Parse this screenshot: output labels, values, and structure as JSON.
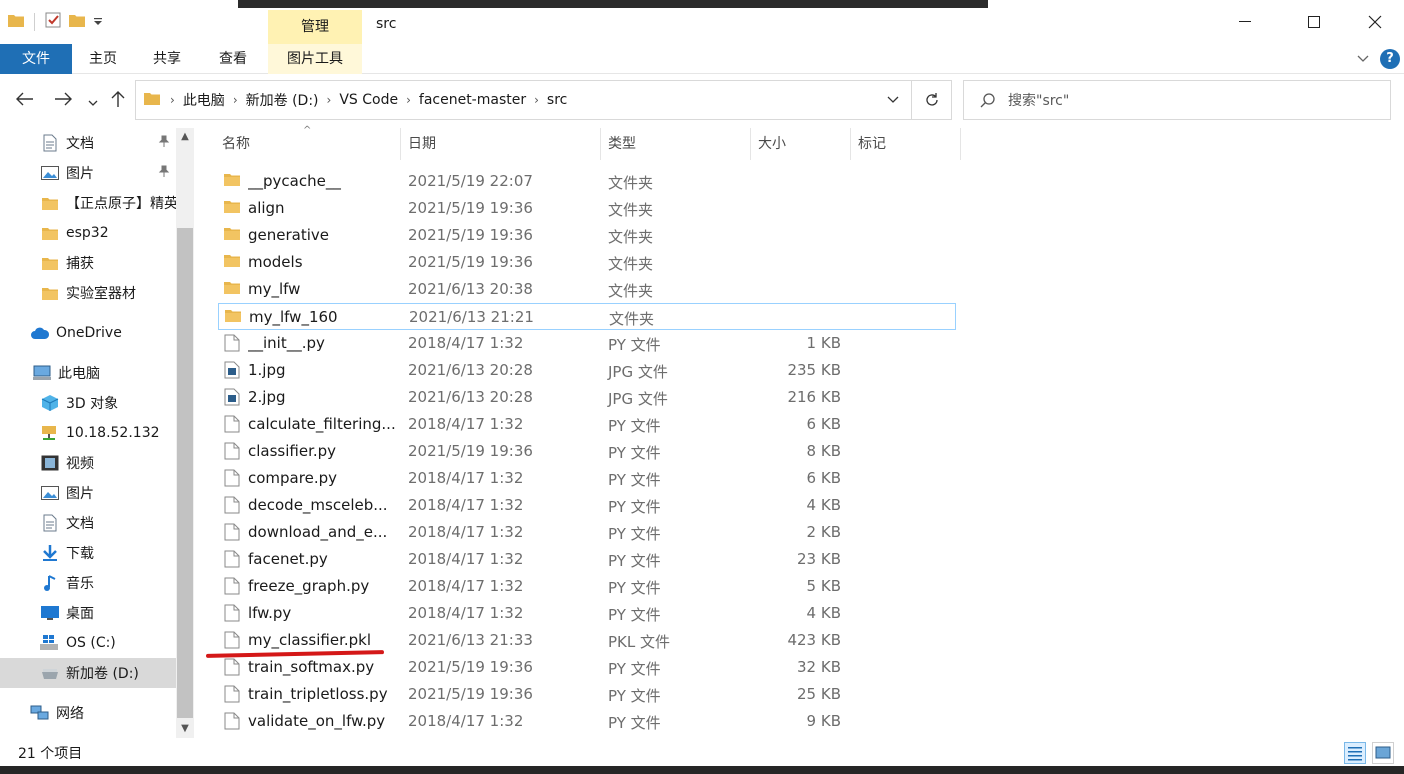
{
  "window": {
    "title": "src",
    "context_tab_top": "管理",
    "minimize": "—",
    "maximize": "☐",
    "close": "✕"
  },
  "ribbon": {
    "tabs": [
      "文件",
      "主页",
      "共享",
      "查看"
    ],
    "context_tab": "图片工具",
    "help": "?"
  },
  "address": {
    "crumbs": [
      "此电脑",
      "新加卷 (D:)",
      "VS Code",
      "facenet-master",
      "src"
    ]
  },
  "search": {
    "placeholder": "搜索\"src\""
  },
  "sidebar": {
    "items": [
      {
        "label": "文档",
        "icon": "document-icon",
        "pinned": true
      },
      {
        "label": "图片",
        "icon": "picture-icon",
        "pinned": true
      },
      {
        "label": "【正点原子】精英",
        "icon": "folder-icon"
      },
      {
        "label": "esp32",
        "icon": "folder-icon"
      },
      {
        "label": "捕获",
        "icon": "folder-icon"
      },
      {
        "label": "实验室器材",
        "icon": "folder-icon"
      },
      {
        "label": "OneDrive",
        "icon": "cloud-icon"
      },
      {
        "label": "此电脑",
        "icon": "computer-icon"
      },
      {
        "label": "3D 对象",
        "icon": "cube-icon"
      },
      {
        "label": "10.18.52.132",
        "icon": "network-drive-icon"
      },
      {
        "label": "视频",
        "icon": "video-icon"
      },
      {
        "label": "图片",
        "icon": "picture-icon"
      },
      {
        "label": "文档",
        "icon": "document-icon"
      },
      {
        "label": "下载",
        "icon": "download-icon"
      },
      {
        "label": "音乐",
        "icon": "music-icon"
      },
      {
        "label": "桌面",
        "icon": "desktop-icon"
      },
      {
        "label": "OS (C:)",
        "icon": "windows-drive-icon"
      },
      {
        "label": "新加卷 (D:)",
        "icon": "drive-icon",
        "selected": true
      },
      {
        "label": "网络",
        "icon": "network-icon"
      }
    ]
  },
  "columns": [
    "名称",
    "日期",
    "类型",
    "大小",
    "标记"
  ],
  "files": [
    {
      "name": "__pycache__",
      "date": "2021/5/19 22:07",
      "type": "文件夹",
      "size": "",
      "kind": "folder"
    },
    {
      "name": "align",
      "date": "2021/5/19 19:36",
      "type": "文件夹",
      "size": "",
      "kind": "folder"
    },
    {
      "name": "generative",
      "date": "2021/5/19 19:36",
      "type": "文件夹",
      "size": "",
      "kind": "folder"
    },
    {
      "name": "models",
      "date": "2021/5/19 19:36",
      "type": "文件夹",
      "size": "",
      "kind": "folder"
    },
    {
      "name": "my_lfw",
      "date": "2021/6/13 20:38",
      "type": "文件夹",
      "size": "",
      "kind": "folder"
    },
    {
      "name": "my_lfw_160",
      "date": "2021/6/13 21:21",
      "type": "文件夹",
      "size": "",
      "kind": "folder",
      "hover": true
    },
    {
      "name": "__init__.py",
      "date": "2018/4/17 1:32",
      "type": "PY 文件",
      "size": "1 KB",
      "kind": "file"
    },
    {
      "name": "1.jpg",
      "date": "2021/6/13 20:28",
      "type": "JPG 文件",
      "size": "235 KB",
      "kind": "image"
    },
    {
      "name": "2.jpg",
      "date": "2021/6/13 20:28",
      "type": "JPG 文件",
      "size": "216 KB",
      "kind": "image"
    },
    {
      "name": "calculate_filtering...",
      "date": "2018/4/17 1:32",
      "type": "PY 文件",
      "size": "6 KB",
      "kind": "file"
    },
    {
      "name": "classifier.py",
      "date": "2021/5/19 19:36",
      "type": "PY 文件",
      "size": "8 KB",
      "kind": "file"
    },
    {
      "name": "compare.py",
      "date": "2018/4/17 1:32",
      "type": "PY 文件",
      "size": "6 KB",
      "kind": "file"
    },
    {
      "name": "decode_msceleb...",
      "date": "2018/4/17 1:32",
      "type": "PY 文件",
      "size": "4 KB",
      "kind": "file"
    },
    {
      "name": "download_and_e...",
      "date": "2018/4/17 1:32",
      "type": "PY 文件",
      "size": "2 KB",
      "kind": "file"
    },
    {
      "name": "facenet.py",
      "date": "2018/4/17 1:32",
      "type": "PY 文件",
      "size": "23 KB",
      "kind": "file"
    },
    {
      "name": "freeze_graph.py",
      "date": "2018/4/17 1:32",
      "type": "PY 文件",
      "size": "5 KB",
      "kind": "file"
    },
    {
      "name": "lfw.py",
      "date": "2018/4/17 1:32",
      "type": "PY 文件",
      "size": "4 KB",
      "kind": "file"
    },
    {
      "name": "my_classifier.pkl",
      "date": "2021/6/13 21:33",
      "type": "PKL 文件",
      "size": "423 KB",
      "kind": "file"
    },
    {
      "name": "train_softmax.py",
      "date": "2021/5/19 19:36",
      "type": "PY 文件",
      "size": "32 KB",
      "kind": "file"
    },
    {
      "name": "train_tripletloss.py",
      "date": "2021/5/19 19:36",
      "type": "PY 文件",
      "size": "25 KB",
      "kind": "file"
    },
    {
      "name": "validate_on_lfw.py",
      "date": "2018/4/17 1:32",
      "type": "PY 文件",
      "size": "9 KB",
      "kind": "file"
    }
  ],
  "status": {
    "count": "21 个项目"
  },
  "colors": {
    "accent": "#1f6fb5",
    "context_tab": "#fff2b3",
    "folder": "#e8b64c",
    "selection": "#d9d9d9",
    "hover_border": "#99d1ff",
    "annotation": "#d41818"
  }
}
